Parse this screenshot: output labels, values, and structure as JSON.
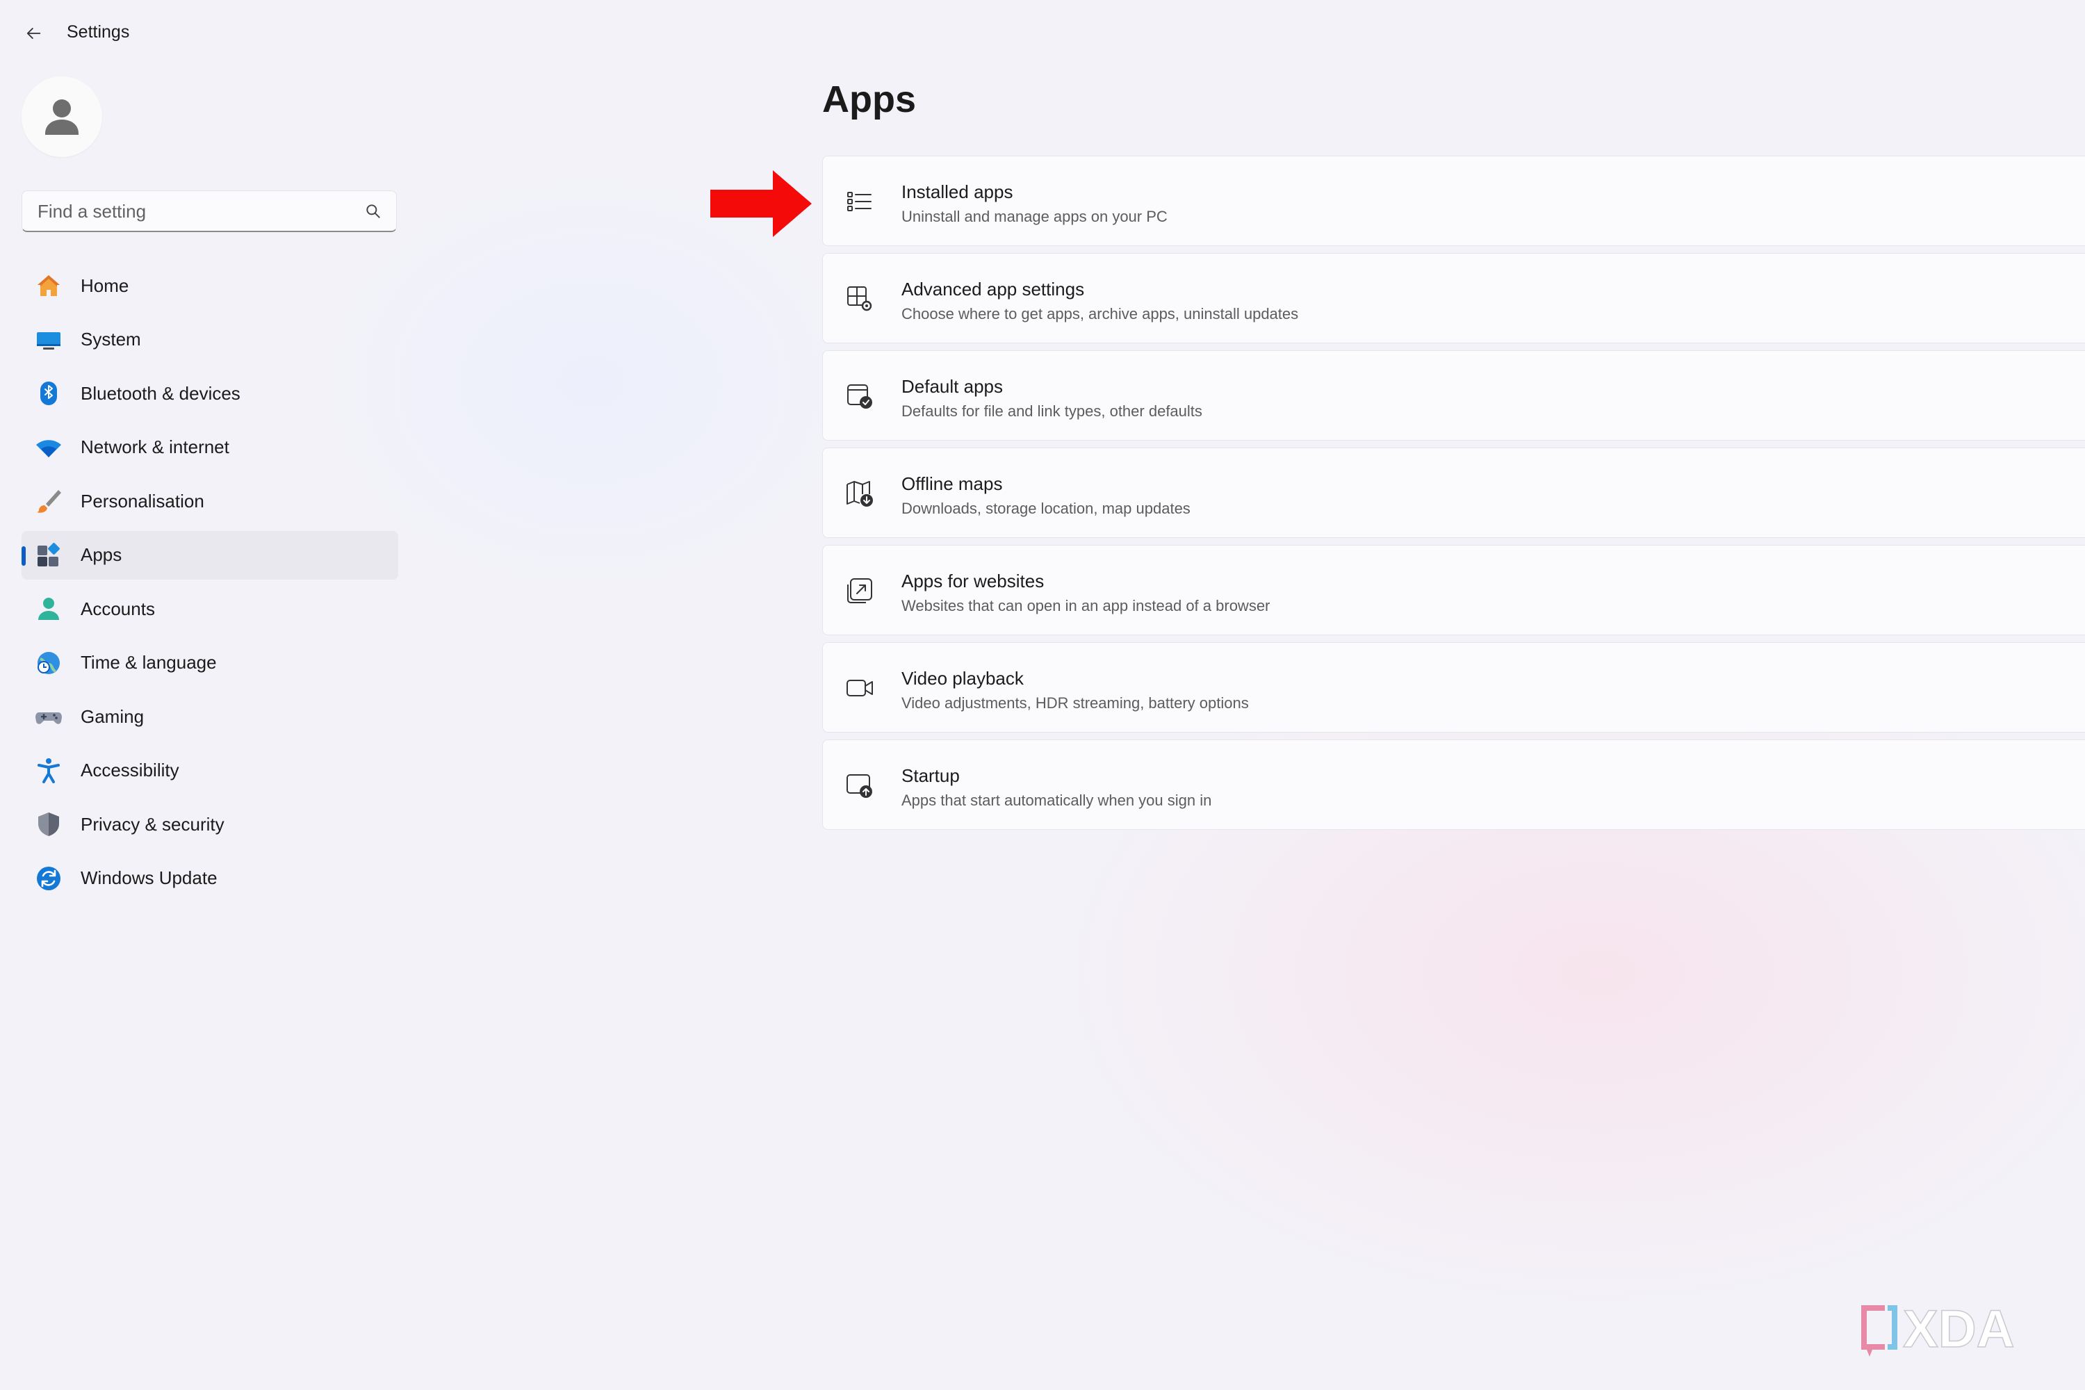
{
  "titlebar": {
    "title": "Settings",
    "back_icon": "arrow-left-icon"
  },
  "search": {
    "placeholder": "Find a setting",
    "icon": "search-icon"
  },
  "sidebar": {
    "items": [
      {
        "label": "Home",
        "icon": "home-icon",
        "active": false
      },
      {
        "label": "System",
        "icon": "monitor-icon",
        "active": false
      },
      {
        "label": "Bluetooth & devices",
        "icon": "bluetooth-icon",
        "active": false
      },
      {
        "label": "Network & internet",
        "icon": "wifi-icon",
        "active": false
      },
      {
        "label": "Personalisation",
        "icon": "paintbrush-icon",
        "active": false
      },
      {
        "label": "Apps",
        "icon": "apps-icon",
        "active": true
      },
      {
        "label": "Accounts",
        "icon": "person-icon",
        "active": false
      },
      {
        "label": "Time & language",
        "icon": "globe-clock-icon",
        "active": false
      },
      {
        "label": "Gaming",
        "icon": "gamepad-icon",
        "active": false
      },
      {
        "label": "Accessibility",
        "icon": "accessibility-icon",
        "active": false
      },
      {
        "label": "Privacy & security",
        "icon": "shield-icon",
        "active": false
      },
      {
        "label": "Windows Update",
        "icon": "refresh-icon",
        "active": false
      }
    ]
  },
  "main": {
    "title": "Apps",
    "cards": [
      {
        "title": "Installed apps",
        "subtitle": "Uninstall and manage apps on your PC",
        "icon": "list-icon"
      },
      {
        "title": "Advanced app settings",
        "subtitle": "Choose where to get apps, archive apps, uninstall updates",
        "icon": "app-gear-icon"
      },
      {
        "title": "Default apps",
        "subtitle": "Defaults for file and link types, other defaults",
        "icon": "default-check-icon"
      },
      {
        "title": "Offline maps",
        "subtitle": "Downloads, storage location, map updates",
        "icon": "map-download-icon"
      },
      {
        "title": "Apps for websites",
        "subtitle": "Websites that can open in an app instead of a browser",
        "icon": "open-external-icon"
      },
      {
        "title": "Video playback",
        "subtitle": "Video adjustments, HDR streaming, battery options",
        "icon": "video-camera-icon"
      },
      {
        "title": "Startup",
        "subtitle": "Apps that start automatically when you sign in",
        "icon": "startup-icon"
      }
    ]
  },
  "annotation": {
    "icon": "red-arrow-icon",
    "color": "#f50a0a"
  },
  "watermark": {
    "text": "XDA"
  },
  "colors": {
    "background": "#f3f2f8",
    "accent": "#0a5fc7",
    "card": "#fbfbfd",
    "active_nav": "#e9e8ef"
  }
}
